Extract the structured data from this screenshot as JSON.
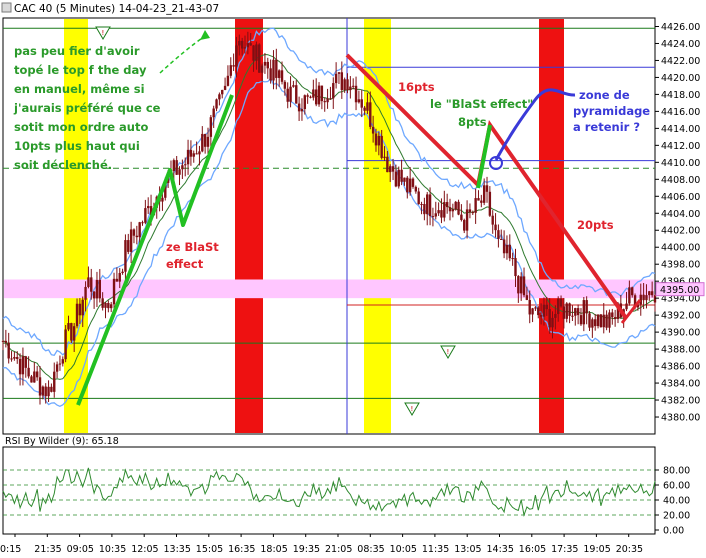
{
  "window_title": "CAC 40 (5 Minutes) 14-04-23_21-43-07",
  "price_chart": {
    "y_min": 4378,
    "y_max": 4427,
    "y_ticks": [
      4380,
      4382,
      4384,
      4386,
      4388,
      4390,
      4392,
      4394,
      4396,
      4398,
      4400,
      4402,
      4404,
      4406,
      4408,
      4410,
      4412,
      4414,
      4416,
      4418,
      4420,
      4422,
      4424,
      4426
    ],
    "last_price_label": "4395.00",
    "grid": "on"
  },
  "rsi_panel": {
    "label": "RSI By Wilder (9): 65.18",
    "y_ticks": [
      "80.00",
      "60.00",
      "40.00",
      "20.00",
      "0.00"
    ]
  },
  "x_axis": {
    "ticks": [
      "0:15",
      "21:35",
      "09:05",
      "10:35",
      "12:05",
      "13:35",
      "15:05",
      "16:35",
      "18:05",
      "19:35",
      "21:05",
      "08:35",
      "10:05",
      "11:35",
      "13:05",
      "14:35",
      "16:05",
      "17:35",
      "19:05",
      "20:35"
    ]
  },
  "annotations": {
    "note_green": [
      "pas peu fier d'avoir",
      "topé le top f the day",
      "en manuel, même si",
      "j'aurais préféré que ce",
      "sotit mon ordre auto",
      "10pts plus haut qui",
      "soit déclenché."
    ],
    "ze_blast": [
      "ze BlaSt",
      "effect"
    ],
    "pts16": "16pts",
    "le_blast": "le \"BlaSt effect\"",
    "pts8": "8pts",
    "zone": [
      "zone de",
      "pyramidage",
      "a retenir ?"
    ],
    "pts20": "20pts"
  },
  "colors": {
    "candles": "#7f0f14",
    "bands": "#6ea8ff",
    "moving_average": "#2f7a2f",
    "red_zone": "#ee1111",
    "yellow_zone": "#ffff00",
    "pink_zone": "#ffc6ff",
    "arrow_green": "#22c022",
    "arrow_red": "#e0242e",
    "annotation_blue": "#3a3ad8"
  },
  "chart_data": {
    "type": "candlestick",
    "series": [
      {
        "name": "RSI By Wilder (9)",
        "last": 65.18
      }
    ],
    "close_path": [
      [
        0.0,
        4389
      ],
      [
        0.04,
        4385
      ],
      [
        0.07,
        4383
      ],
      [
        0.09,
        4388
      ],
      [
        0.11,
        4391
      ],
      [
        0.13,
        4396
      ],
      [
        0.16,
        4393
      ],
      [
        0.19,
        4400
      ],
      [
        0.22,
        4404
      ],
      [
        0.25,
        4408
      ],
      [
        0.28,
        4410
      ],
      [
        0.31,
        4413
      ],
      [
        0.34,
        4418
      ],
      [
        0.36,
        4425
      ],
      [
        0.38,
        4423
      ],
      [
        0.41,
        4421
      ],
      [
        0.44,
        4418
      ],
      [
        0.47,
        4417
      ],
      [
        0.5,
        4419
      ],
      [
        0.53,
        4420
      ],
      [
        0.56,
        4416
      ],
      [
        0.59,
        4410
      ],
      [
        0.62,
        4407
      ],
      [
        0.65,
        4405
      ],
      [
        0.68,
        4405
      ],
      [
        0.71,
        4403
      ],
      [
        0.74,
        4406
      ],
      [
        0.76,
        4400
      ],
      [
        0.78,
        4398
      ],
      [
        0.81,
        4392
      ],
      [
        0.84,
        4392
      ],
      [
        0.87,
        4393
      ],
      [
        0.9,
        4392
      ],
      [
        0.93,
        4391
      ],
      [
        0.96,
        4394
      ],
      [
        1.0,
        4395
      ]
    ]
  }
}
